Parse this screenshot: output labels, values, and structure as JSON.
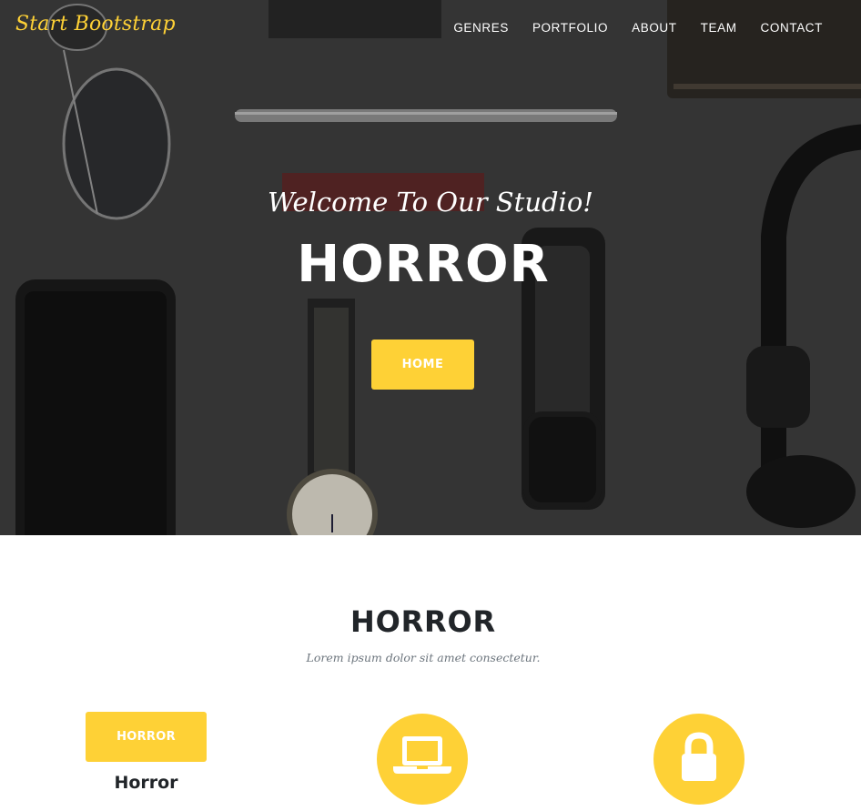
{
  "navbar": {
    "brand": "Start Bootstrap",
    "links": [
      "GENRES",
      "PORTFOLIO",
      "ABOUT",
      "TEAM",
      "CONTACT"
    ]
  },
  "hero": {
    "lead": "Welcome To Our Studio!",
    "heading": "HORROR",
    "button_label": "HOME"
  },
  "services": {
    "heading": "HORROR",
    "subheading": "Lorem ipsum dolor sit amet consectetur.",
    "items": [
      {
        "button_label": "HORROR",
        "title": "Horror"
      },
      {
        "icon": "laptop-icon"
      },
      {
        "icon": "lock-icon"
      }
    ]
  },
  "colors": {
    "accent": "#fed136",
    "dark_text": "#212529",
    "muted_text": "#6c757d"
  }
}
